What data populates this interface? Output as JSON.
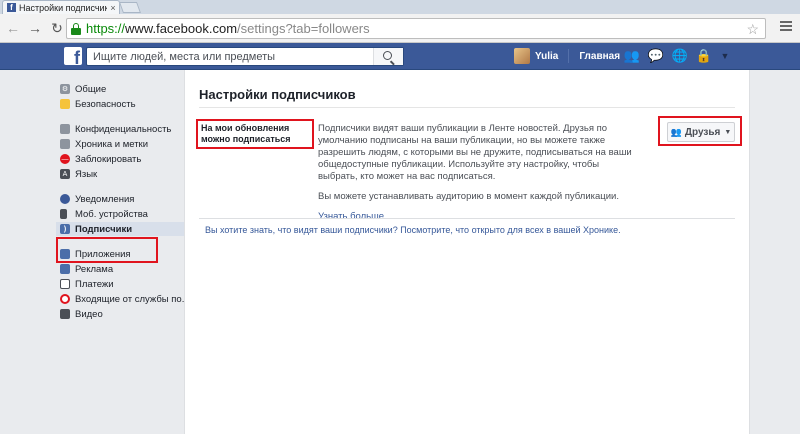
{
  "browser": {
    "tab_title": "Настройки подписчиков",
    "url_https": "https://",
    "url_domain": "www.facebook.com",
    "url_path": "/settings?tab=followers"
  },
  "fb_header": {
    "search_placeholder": "Ищите людей, места или предметы",
    "user_name": "Yulia",
    "home_label": "Главная"
  },
  "sidebar": {
    "groups": [
      [
        {
          "label": "Общие",
          "icon": "gear-icon",
          "color": "#8d949e"
        },
        {
          "label": "Безопасность",
          "icon": "shield-icon",
          "color": "#f5c33b"
        }
      ],
      [
        {
          "label": "Конфиденциальность",
          "icon": "lock-icon",
          "color": "#8d949e"
        },
        {
          "label": "Хроника и метки",
          "icon": "timeline-icon",
          "color": "#8d949e"
        },
        {
          "label": "Заблокировать",
          "icon": "block-icon",
          "color": "#e0141e"
        },
        {
          "label": "Язык",
          "icon": "language-icon",
          "color": "#4b4f56"
        }
      ],
      [
        {
          "label": "Уведомления",
          "icon": "globe-icon",
          "color": "#3b5998"
        },
        {
          "label": "Моб. устройства",
          "icon": "mobile-icon",
          "color": "#4b4f56"
        },
        {
          "label": "Подписчики",
          "icon": "rss-icon",
          "color": "#4b6ea9",
          "active": true
        }
      ],
      [
        {
          "label": "Приложения",
          "icon": "apps-icon",
          "color": "#4b6ea9"
        },
        {
          "label": "Реклама",
          "icon": "ads-icon",
          "color": "#4b6ea9"
        },
        {
          "label": "Платежи",
          "icon": "payments-icon",
          "color": "#4b4f56"
        },
        {
          "label": "Входящие от службы по...",
          "icon": "support-icon",
          "color": "#e0141e"
        },
        {
          "label": "Видео",
          "icon": "video-icon",
          "color": "#4b4f56"
        }
      ]
    ]
  },
  "main": {
    "title": "Настройки подписчиков",
    "row_label": "На мои обновления можно подписаться",
    "paragraph1": "Подписчики видят ваши публикации в Ленте новостей. Друзья по умолчанию подписаны на ваши публикации, но вы можете также разрешить людям, с которыми вы не дружите, подписываться на ваши общедоступные публикации. Используйте эту настройку, чтобы выбрать, кто может на вас подписаться.",
    "paragraph2": "Вы можете устанавливать аудиторию в момент каждой публикации.",
    "learn_more": "Узнать больше.",
    "audience_button": "Друзья",
    "footer_text": "Вы хотите знать, что видят ваши подписчики? Посмотрите, что открыто для всех в вашей Хронике."
  },
  "colors": {
    "fb_blue": "#3b5998",
    "annotation_red": "#e0141e",
    "link": "#365899"
  }
}
